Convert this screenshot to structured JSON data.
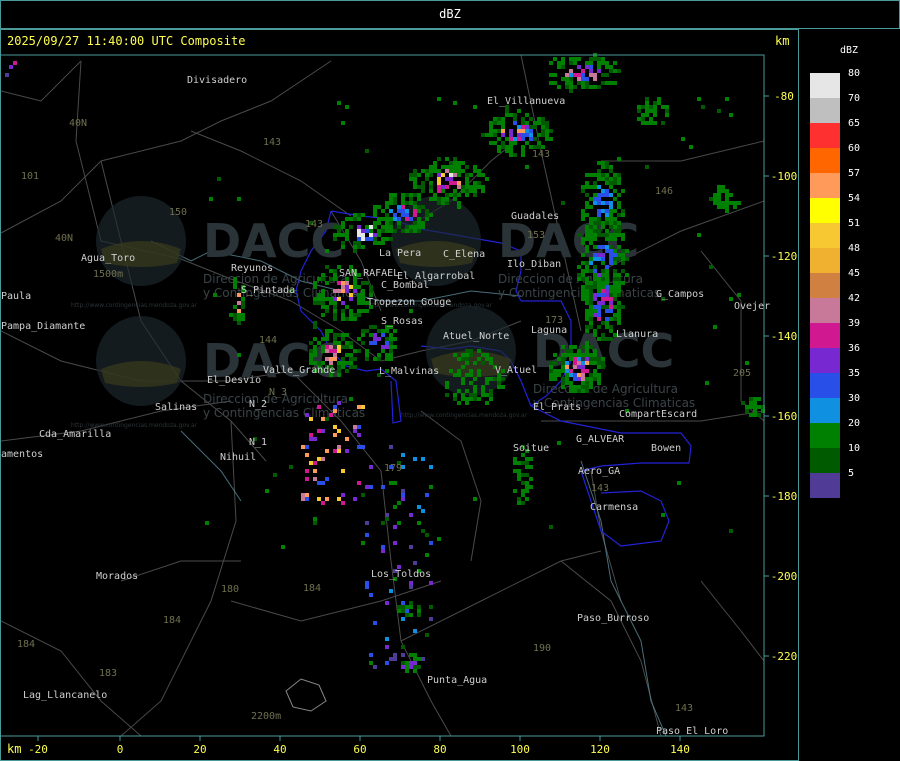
{
  "header": {
    "title": "dBZ"
  },
  "map": {
    "timestamp": "2025/09/27 11:40:00 UTC Composite",
    "km_top": "km",
    "km_bottom": "km",
    "x_ticks": [
      "-20",
      "0",
      "20",
      "40",
      "60",
      "80",
      "100",
      "120",
      "140"
    ],
    "y_ticks": [
      "-80",
      "-100",
      "-120",
      "-140",
      "-160",
      "-180",
      "-200",
      "-220"
    ],
    "places": [
      "Divisadero",
      "El_Villanueva",
      "Guadales",
      "G_Campos",
      "Agua_Toro",
      "Paula",
      "Pampa_Diamante",
      "Reyunos",
      "S_Pintada",
      "SAN_RAFAEL",
      "El_Algarrobal",
      "C_Bombal",
      "Tropezon Gouge",
      "Atuel_Norte",
      "Ilo_Diban",
      "La Pera",
      "C_Elena",
      "S_Rosas",
      "L_Malvinas",
      "V_Atuel",
      "Valle_Grande",
      "El_Desvio",
      "Salinas",
      "Cda_Amarilla",
      "N_2",
      "N_1",
      "Nihuil",
      "Soitue",
      "Compart",
      "Escard",
      "Bowen",
      "G_ALVEAR",
      "Aero_GA",
      "Carmensa",
      "Los_Toldos",
      "Morados",
      "Paso_Burroso",
      "Punta_Agua",
      "Lag_Llancanelo",
      "Paso_El_Loro",
      "Ovejer",
      "amentos",
      "El_Prats",
      "Laguna",
      "Llanura"
    ],
    "road_numbers": [
      "143",
      "40N",
      "101",
      "150",
      "40N",
      "143",
      "153",
      "146",
      "173",
      "205",
      "143",
      "144",
      "179",
      "184",
      "143",
      "180",
      "184",
      "183",
      "184",
      "190",
      "143",
      "N_3"
    ],
    "elevation": [
      "1500m",
      "2200m"
    ],
    "watermark": {
      "brand": "DACC",
      "line1": "Direccion de Agricultura",
      "line2": "y Contingencias Climaticas",
      "url": "http://www.contingencias.mendoza.gov.ar"
    }
  },
  "legend": {
    "unit": "dBZ",
    "items": [
      {
        "label": "80",
        "color": "#e6e6e6"
      },
      {
        "label": "70",
        "color": "#bfbfbf"
      },
      {
        "label": "65",
        "color": "#ff3030"
      },
      {
        "label": "60",
        "color": "#ff6600"
      },
      {
        "label": "57",
        "color": "#ff9a5a"
      },
      {
        "label": "54",
        "color": "#ffff00"
      },
      {
        "label": "51",
        "color": "#f8c832"
      },
      {
        "label": "48",
        "color": "#f0b030"
      },
      {
        "label": "45",
        "color": "#d08040"
      },
      {
        "label": "42",
        "color": "#c87898"
      },
      {
        "label": "39",
        "color": "#d01890"
      },
      {
        "label": "36",
        "color": "#7828d0"
      },
      {
        "label": "35",
        "color": "#2850e8"
      },
      {
        "label": "30",
        "color": "#1090e0"
      },
      {
        "label": "20",
        "color": "#008000"
      },
      {
        "label": "10",
        "color": "#005a00"
      },
      {
        "label": "5",
        "color": "#503c96"
      }
    ]
  }
}
